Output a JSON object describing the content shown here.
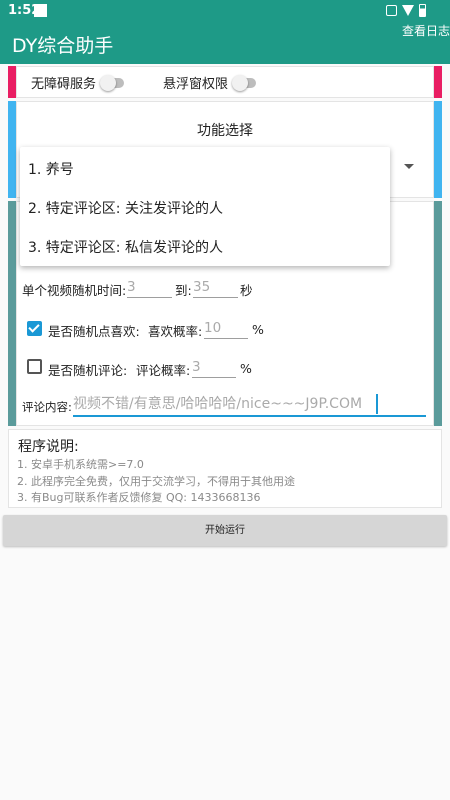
{
  "status": {
    "time": "1:52"
  },
  "app": {
    "title": "DY综合助手",
    "log_action": "查看日志"
  },
  "switches": {
    "accessibility": {
      "label": "无障碍服务",
      "on": false
    },
    "overlay": {
      "label": "悬浮窗权限",
      "on": false
    }
  },
  "function": {
    "title": "功能选择",
    "options": [
      "1. 养号",
      "2. 特定评论区: 关注发评论的人",
      "3. 特定评论区: 私信发评论的人"
    ]
  },
  "settings": {
    "video_time": {
      "label": "单个视频随机时间:",
      "from": "3",
      "to_label": "到:",
      "to": "35",
      "unit": "秒"
    },
    "like": {
      "checked": true,
      "label": "是否随机点喜欢:",
      "prob_label": "喜欢概率:",
      "prob": "10",
      "unit": "%"
    },
    "comment": {
      "checked": false,
      "label": "是否随机评论:",
      "prob_label": "评论概率:",
      "prob": "3",
      "unit": "%"
    },
    "content": {
      "label": "评论内容:",
      "value": "视频不错/有意思/哈哈哈哈/nice~~~J9P.COM"
    }
  },
  "description": {
    "title": "程序说明:",
    "lines": [
      "1. 安卓手机系统需>=7.0",
      "2. 此程序完全免费，仅用于交流学习，不得用于其他用途",
      "3. 有Bug可联系作者反馈修复 QQ: 1433668136"
    ]
  },
  "actions": {
    "run": "开始运行"
  },
  "colors": {
    "primary": "#1e9a87",
    "accent": "#1a98d5",
    "pink": "#e91e63",
    "sky": "#40b4f0",
    "teal": "#5b9b9b"
  }
}
